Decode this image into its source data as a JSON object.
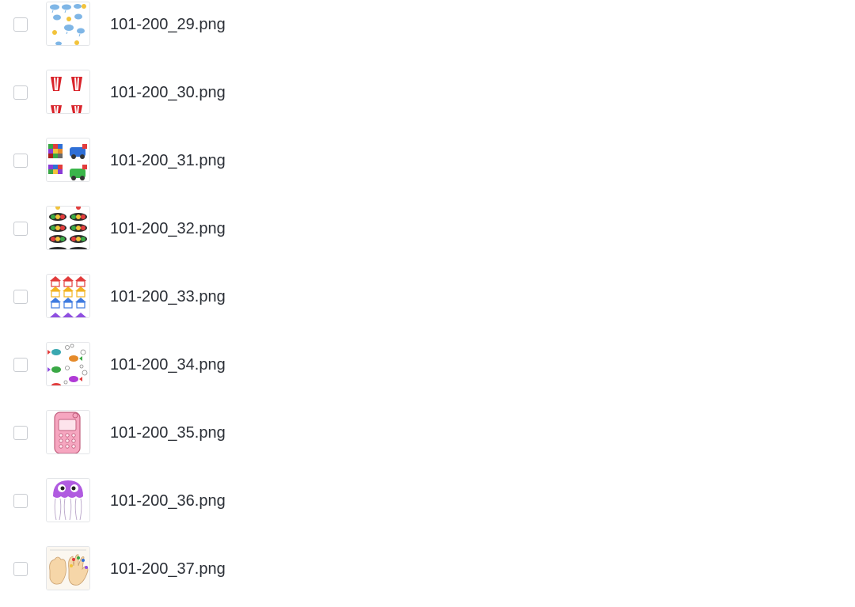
{
  "files": [
    {
      "name": "101-200_29.png",
      "thumbnail_icon": "weather-clouds-worksheet-icon"
    },
    {
      "name": "101-200_30.png",
      "thumbnail_icon": "red-striped-cups-icon"
    },
    {
      "name": "101-200_31.png",
      "thumbnail_icon": "colored-grid-vehicles-icon"
    },
    {
      "name": "101-200_32.png",
      "thumbnail_icon": "traffic-lights-worksheet-icon"
    },
    {
      "name": "101-200_33.png",
      "thumbnail_icon": "colored-houses-icon"
    },
    {
      "name": "101-200_34.png",
      "thumbnail_icon": "fish-worksheet-icon"
    },
    {
      "name": "101-200_35.png",
      "thumbnail_icon": "pink-phone-icon"
    },
    {
      "name": "101-200_36.png",
      "thumbnail_icon": "purple-jellyfish-icon"
    },
    {
      "name": "101-200_37.png",
      "thumbnail_icon": "hands-worksheet-icon"
    }
  ]
}
